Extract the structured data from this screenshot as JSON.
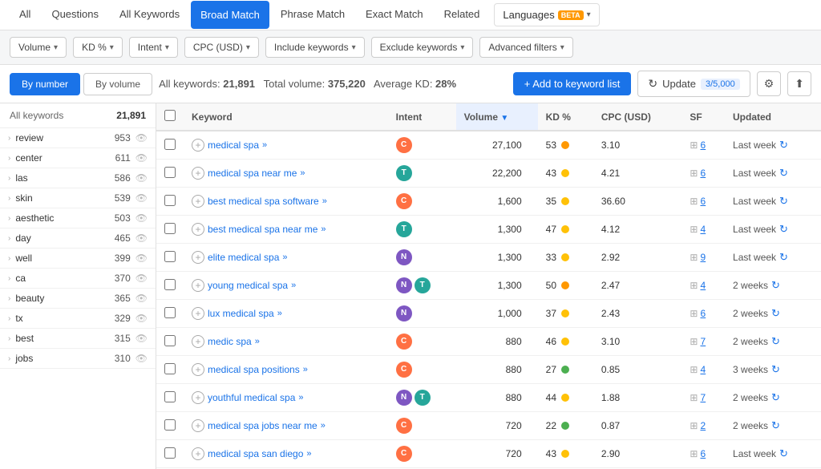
{
  "tabs": {
    "items": [
      {
        "label": "All",
        "active": false,
        "selected": false
      },
      {
        "label": "Questions",
        "active": false,
        "selected": false
      },
      {
        "label": "All Keywords",
        "active": false,
        "selected": false
      },
      {
        "label": "Broad Match",
        "active": false,
        "selected": true
      },
      {
        "label": "Phrase Match",
        "active": false,
        "selected": false
      },
      {
        "label": "Exact Match",
        "active": false,
        "selected": false
      },
      {
        "label": "Related",
        "active": false,
        "selected": false
      }
    ],
    "languages_label": "Languages",
    "beta_label": "BETA"
  },
  "filters": [
    {
      "label": "Volume",
      "id": "volume"
    },
    {
      "label": "KD %",
      "id": "kd"
    },
    {
      "label": "Intent",
      "id": "intent"
    },
    {
      "label": "CPC (USD)",
      "id": "cpc"
    },
    {
      "label": "Include keywords",
      "id": "include"
    },
    {
      "label": "Exclude keywords",
      "id": "exclude"
    },
    {
      "label": "Advanced filters",
      "id": "advanced"
    }
  ],
  "summary": {
    "all_keywords_label": "All keywords:",
    "all_keywords_value": "21,891",
    "total_volume_label": "Total volume:",
    "total_volume_value": "375,220",
    "avg_kd_label": "Average KD:",
    "avg_kd_value": "28%",
    "add_btn_label": "+ Add to keyword list",
    "update_btn_label": "Update",
    "update_count": "3/5,000"
  },
  "view_toggle": {
    "by_number": "By number",
    "by_volume": "By volume"
  },
  "sidebar": {
    "header_label": "All keywords",
    "header_count": "21,891",
    "items": [
      {
        "label": "review",
        "count": 953
      },
      {
        "label": "center",
        "count": 611
      },
      {
        "label": "las",
        "count": 586
      },
      {
        "label": "skin",
        "count": 539
      },
      {
        "label": "aesthetic",
        "count": 503
      },
      {
        "label": "day",
        "count": 465
      },
      {
        "label": "well",
        "count": 399
      },
      {
        "label": "ca",
        "count": 370
      },
      {
        "label": "beauty",
        "count": 365
      },
      {
        "label": "tx",
        "count": 329
      },
      {
        "label": "best",
        "count": 315
      },
      {
        "label": "jobs",
        "count": 310
      }
    ]
  },
  "table": {
    "columns": [
      {
        "label": "Keyword",
        "id": "keyword"
      },
      {
        "label": "Intent",
        "id": "intent"
      },
      {
        "label": "Volume",
        "id": "volume",
        "sorted": true
      },
      {
        "label": "KD %",
        "id": "kd"
      },
      {
        "label": "CPC (USD)",
        "id": "cpc"
      },
      {
        "label": "SF",
        "id": "sf"
      },
      {
        "label": "Updated",
        "id": "updated"
      }
    ],
    "rows": [
      {
        "keyword": "medical spa",
        "intent": [
          "C"
        ],
        "volume": "27,100",
        "kd": 53,
        "kd_color": "orange",
        "cpc": "3.10",
        "sf_count": 6,
        "updated": "Last week"
      },
      {
        "keyword": "medical spa near me",
        "intent": [
          "T"
        ],
        "volume": "22,200",
        "kd": 43,
        "kd_color": "yellow",
        "cpc": "4.21",
        "sf_count": 6,
        "updated": "Last week"
      },
      {
        "keyword": "best medical spa software",
        "intent": [
          "C"
        ],
        "volume": "1,600",
        "kd": 35,
        "kd_color": "yellow",
        "cpc": "36.60",
        "sf_count": 6,
        "updated": "Last week"
      },
      {
        "keyword": "best medical spa near me",
        "intent": [
          "T"
        ],
        "volume": "1,300",
        "kd": 47,
        "kd_color": "yellow",
        "cpc": "4.12",
        "sf_count": 4,
        "updated": "Last week"
      },
      {
        "keyword": "elite medical spa",
        "intent": [
          "N"
        ],
        "volume": "1,300",
        "kd": 33,
        "kd_color": "yellow",
        "cpc": "2.92",
        "sf_count": 9,
        "updated": "Last week"
      },
      {
        "keyword": "young medical spa",
        "intent": [
          "N",
          "T"
        ],
        "volume": "1,300",
        "kd": 50,
        "kd_color": "orange",
        "cpc": "2.47",
        "sf_count": 4,
        "updated": "2 weeks"
      },
      {
        "keyword": "lux medical spa",
        "intent": [
          "N"
        ],
        "volume": "1,000",
        "kd": 37,
        "kd_color": "yellow",
        "cpc": "2.43",
        "sf_count": 6,
        "updated": "2 weeks"
      },
      {
        "keyword": "medic spa",
        "intent": [
          "C"
        ],
        "volume": "880",
        "kd": 46,
        "kd_color": "yellow",
        "cpc": "3.10",
        "sf_count": 7,
        "updated": "2 weeks"
      },
      {
        "keyword": "medical spa positions",
        "intent": [
          "C"
        ],
        "volume": "880",
        "kd": 27,
        "kd_color": "green",
        "cpc": "0.85",
        "sf_count": 4,
        "updated": "3 weeks"
      },
      {
        "keyword": "youthful medical spa",
        "intent": [
          "N",
          "T"
        ],
        "volume": "880",
        "kd": 44,
        "kd_color": "yellow",
        "cpc": "1.88",
        "sf_count": 7,
        "updated": "2 weeks"
      },
      {
        "keyword": "medical spa jobs near me",
        "intent": [
          "C"
        ],
        "volume": "720",
        "kd": 22,
        "kd_color": "green",
        "cpc": "0.87",
        "sf_count": 2,
        "updated": "2 weeks"
      },
      {
        "keyword": "medical spa san diego",
        "intent": [
          "C"
        ],
        "volume": "720",
        "kd": 43,
        "kd_color": "yellow",
        "cpc": "2.90",
        "sf_count": 6,
        "updated": "Last week"
      }
    ]
  }
}
